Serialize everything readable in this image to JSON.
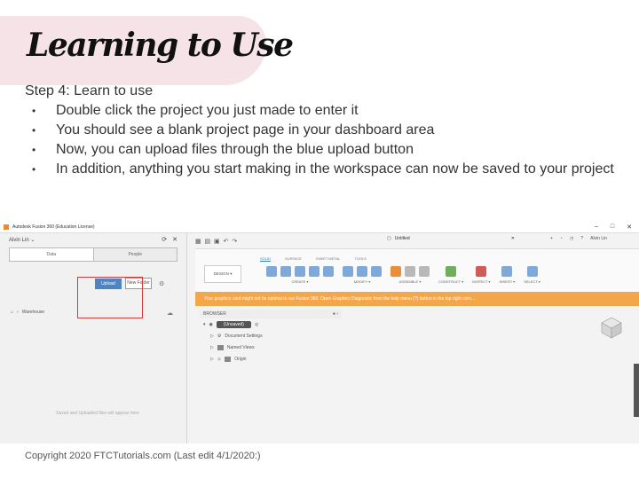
{
  "slide": {
    "title": "Learning to Use",
    "step": "Step 4: Learn to use",
    "bullets": [
      "Double click the project you just made to enter it",
      "You should see a blank project page in your dashboard area",
      "Now, you can upload files through the blue upload button",
      "In addition, anything you start making in the workspace can now be saved to your project"
    ],
    "copyright": "Copyright 2020 FTCTutorials.com (Last edit 4/1/2020:)"
  },
  "colors": {
    "accent_blob": "#f6e3e8",
    "upload_button": "#4d84c4",
    "warning_bar": "#f4a64a",
    "highlight_box": "#d23a3a"
  },
  "app": {
    "window_title": "Autodesk Fusion 360 (Education License)",
    "window_controls": [
      "–",
      "□",
      "✕"
    ],
    "left_panel": {
      "user": "Alvin Lin ⌄",
      "tabs": [
        "Data",
        "People"
      ],
      "upload_label": "Upload",
      "new_folder_label": "New Folder",
      "breadcrumb": "Warehouse",
      "empty_note": "Saved and Uploaded files will appear here"
    },
    "document_tab": "Untitled",
    "top_user": "Alvin Lin",
    "ribbon": {
      "tabs": [
        "SOLID",
        "SURFACE",
        "SHEET METAL",
        "TOOLS"
      ],
      "design_dropdown": "DESIGN ▾",
      "groups": [
        "CREATE ▾",
        "MODIFY ▾",
        "ASSEMBLE ▾",
        "CONSTRUCT ▾",
        "INSPECT ▾",
        "INSERT ▾",
        "SELECT ▾"
      ]
    },
    "warning": "Your graphics card might not be optimal to run Fusion 360. Open Graphics Diagnostic from the help menu (?) button in the top right corn...",
    "browser": {
      "header": "BROWSER",
      "root": "(Unsaved)",
      "items": [
        "Document Settings",
        "Named Views",
        "Origin"
      ]
    }
  }
}
